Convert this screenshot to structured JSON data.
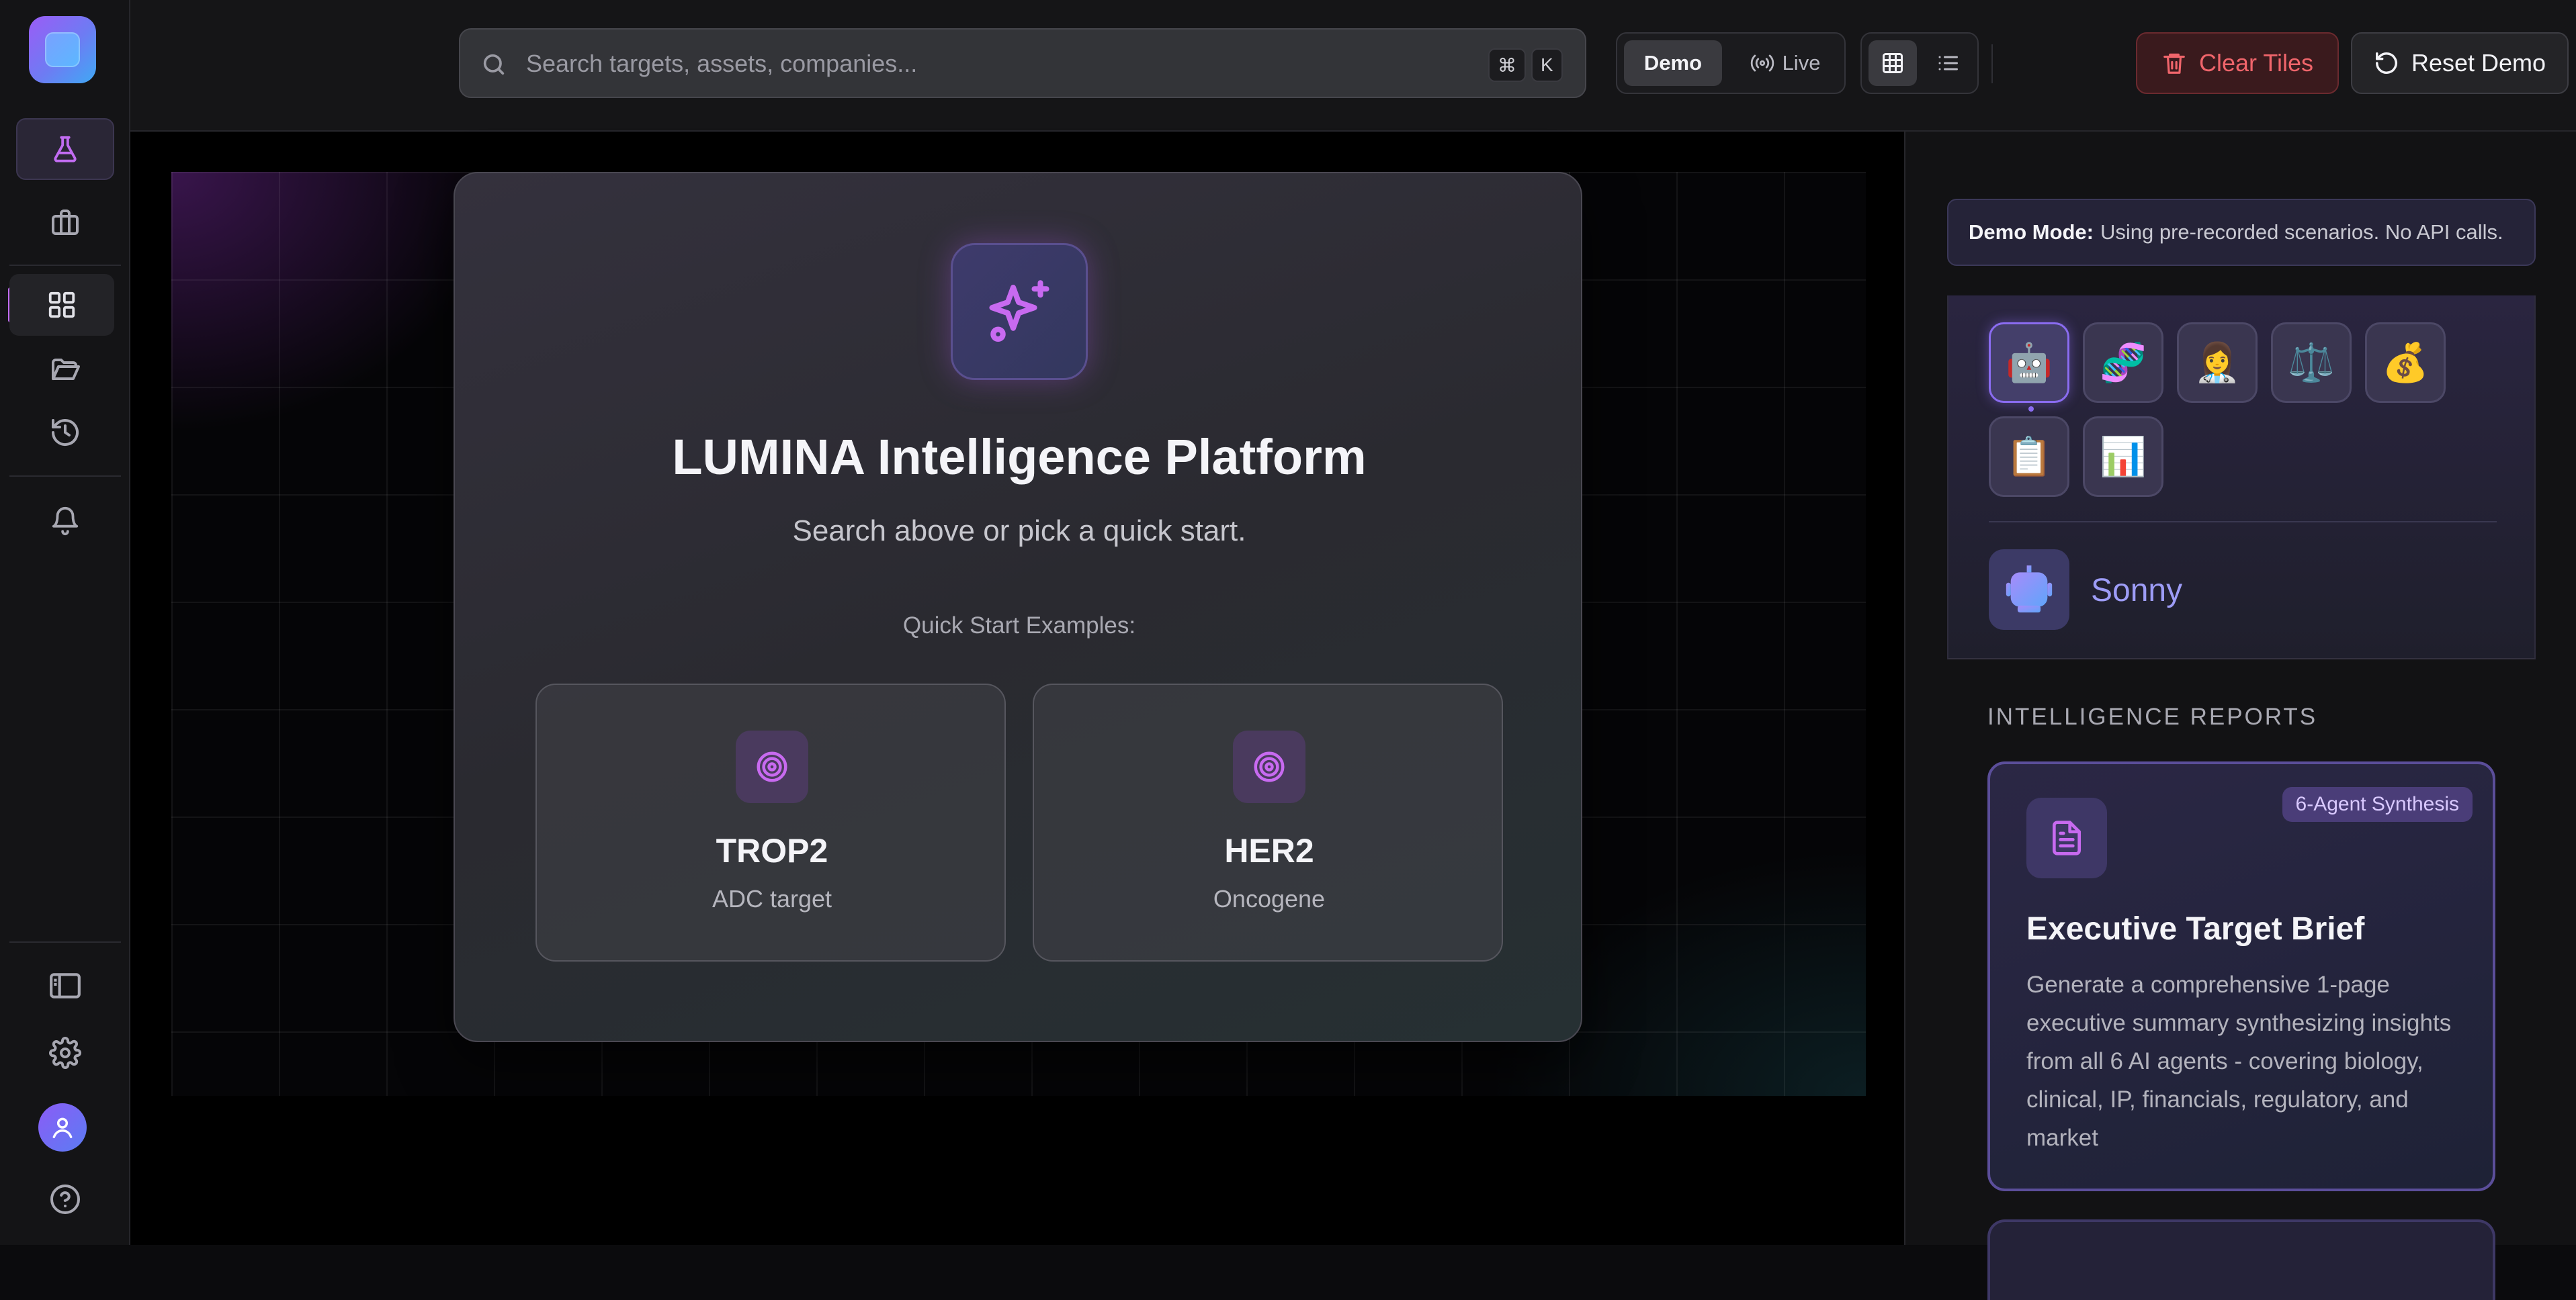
{
  "topbar": {
    "search_placeholder": "Search targets, assets, companies...",
    "shortcut_mod": "⌘",
    "shortcut_key": "K",
    "mode_demo": "Demo",
    "mode_live": "Live",
    "clear_label": "Clear Tiles",
    "reset_label": "Reset Demo"
  },
  "hero": {
    "title": "LUMINA Intelligence Platform",
    "subtitle": "Search above or pick a quick start.",
    "quick_start_label": "Quick Start Examples:",
    "examples": [
      {
        "title": "TROP2",
        "subtitle": "ADC target"
      },
      {
        "title": "HER2",
        "subtitle": "Oncogene"
      }
    ]
  },
  "right_panel": {
    "demo_mode_label": "Demo Mode:",
    "demo_mode_text": "Using pre-recorded scenarios. No API calls.",
    "agents": [
      "🤖",
      "🧬",
      "👩‍⚕️",
      "⚖️",
      "💰",
      "📋",
      "📊"
    ],
    "selected_agent_name": "Sonny",
    "reports_heading": "INTELLIGENCE REPORTS",
    "report": {
      "badge": "6-Agent Synthesis",
      "title": "Executive Target Brief",
      "description": "Generate a comprehensive 1-page executive summary synthesizing insights from all 6 AI agents - covering biology, clinical, IP, financials, regulatory, and market"
    }
  },
  "colors": {
    "accent": "#c26cf2",
    "danger": "#f0656b",
    "agent_name": "#9d9cf6"
  }
}
